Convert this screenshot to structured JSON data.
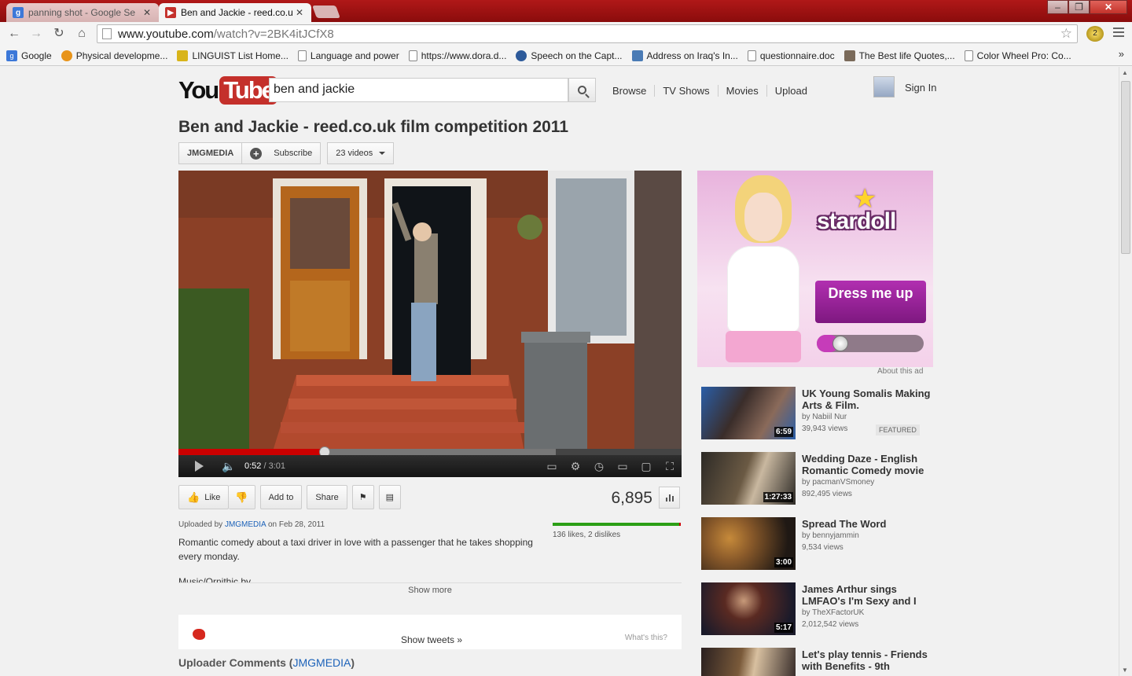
{
  "browser": {
    "tabs": [
      {
        "title": "panning shot - Google Se",
        "favicon": "google-search-icon",
        "active": false
      },
      {
        "title": "Ben and Jackie - reed.co.u",
        "favicon": "youtube-icon",
        "active": true
      }
    ],
    "window_buttons": {
      "minimize": "–",
      "maximize": "❐",
      "close": "✕"
    },
    "url_host": "www.youtube.com",
    "url_path": "/watch?v=2BK4itJCfX8",
    "bookmarks": [
      {
        "label": "Google",
        "icon": "google-icon"
      },
      {
        "label": "Physical developme...",
        "icon": "sun-icon"
      },
      {
        "label": "LINGUIST List Home...",
        "icon": "linguist-icon"
      },
      {
        "label": "Language and power",
        "icon": "page-icon"
      },
      {
        "label": "https://www.dora.d...",
        "icon": "page-icon"
      },
      {
        "label": "Speech on the Capt...",
        "icon": "seal-icon"
      },
      {
        "label": "Address on Iraq's In...",
        "icon": "building-icon"
      },
      {
        "label": "questionnaire.doc",
        "icon": "page-icon"
      },
      {
        "label": "The Best life Quotes,...",
        "icon": "quote-icon"
      },
      {
        "label": "Color Wheel Pro: Co...",
        "icon": "page-icon"
      }
    ],
    "bookmarks_more": "»"
  },
  "youtube": {
    "logo_you": "You",
    "logo_tube": "Tube",
    "search_value": "ben and jackie",
    "nav": [
      "Browse",
      "TV Shows",
      "Movies",
      "Upload"
    ],
    "sign_in": "Sign In"
  },
  "video": {
    "title": "Ben and Jackie - reed.co.uk film competition 2011",
    "channel": "JMGMEDIA",
    "subscribe": "Subscribe",
    "videos_count": "23 videos",
    "progress_fraction": 0.29,
    "buffered_fraction": 0.75,
    "time_current": "0:52",
    "time_separator": " / ",
    "time_total": "3:01",
    "actions": {
      "like": "Like",
      "add_to": "Add to",
      "share": "Share"
    },
    "view_count": "6,895",
    "likes_text": "136 likes, 2 dislikes",
    "like_fraction": 0.985,
    "uploaded_prefix": "Uploaded by",
    "uploaded_channel": "JMGMEDIA",
    "uploaded_suffix": "on Feb 28, 2011",
    "description": "Romantic comedy about a taxi driver in love with a passenger that he takes shopping every monday.",
    "description_cut": "Music/Ornithic by",
    "show_more": "Show more",
    "show_tweets": "Show tweets",
    "whats_this": "What's this?",
    "comments_prefix": "Uploader Comments",
    "comments_channel": "JMGMEDIA"
  },
  "ad": {
    "brand": "stardoll",
    "cta": "Dress me up",
    "about": "About this ad",
    "accent": "#9c239b"
  },
  "related": [
    {
      "title": "UK Young Somalis Making Arts & Film.",
      "by": "by Nabiil Nur",
      "views": "39,943 views",
      "duration": "6:59",
      "badge": "FEATURED",
      "thumb_colors": [
        "#3a2d2a",
        "#2a5ea8"
      ]
    },
    {
      "title": "Wedding Daze - English Romantic Comedy movie",
      "by": "by pacmanVSmoney",
      "views": "892,495 views",
      "duration": "1:27:33",
      "thumb_colors": [
        "#6b5a44",
        "#2d2a26"
      ]
    },
    {
      "title": "Spread The Word",
      "by": "by bennyjammin",
      "views": "9,534 views",
      "duration": "3:00",
      "thumb_colors": [
        "#8a5a2a",
        "#1f1814"
      ]
    },
    {
      "title": "James Arthur sings LMFAO's I'm Sexy and I",
      "by": "by TheXFactorUK",
      "views": "2,012,542 views",
      "duration": "5:17",
      "thumb_colors": [
        "#5a2a22",
        "#1a1a2a"
      ]
    },
    {
      "title": "Let's play tennis - Friends with Benefits - 9th",
      "by": "",
      "views": "",
      "duration": "",
      "thumb_colors": [
        "#7a5a3a",
        "#2a2020"
      ]
    }
  ]
}
